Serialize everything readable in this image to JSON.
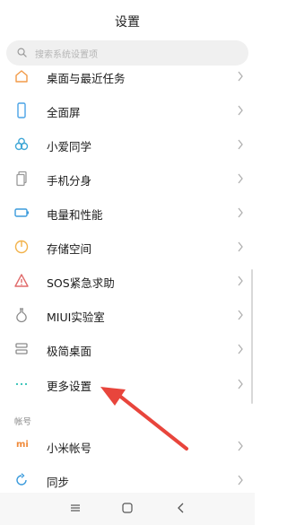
{
  "header": {
    "title": "设置"
  },
  "search": {
    "placeholder": "搜索系统设置项"
  },
  "rows": [
    {
      "label": "桌面与最近任务",
      "icon": "home-screen-icon",
      "color": "#f29a48"
    },
    {
      "label": "全面屏",
      "icon": "phone-screen-icon",
      "color": "#4aa3e6"
    },
    {
      "label": "小爱同学",
      "icon": "assistant-icon",
      "color": "#3fa7d6"
    },
    {
      "label": "手机分身",
      "icon": "second-space-icon",
      "color": "#9a9a9a"
    },
    {
      "label": "电量和性能",
      "icon": "battery-icon",
      "color": "#3b9bdc"
    },
    {
      "label": "存储空间",
      "icon": "storage-icon",
      "color": "#f2b24a"
    },
    {
      "label": "SOS紧急求助",
      "icon": "sos-warning-icon",
      "color": "#e06a6a"
    },
    {
      "label": "MIUI实验室",
      "icon": "lab-flask-icon",
      "color": "#8a8a8a"
    },
    {
      "label": "极简桌面",
      "icon": "simple-desktop-icon",
      "color": "#8a8a8a"
    },
    {
      "label": "更多设置",
      "icon": "more-dots-icon",
      "color": "#2ec0b5"
    }
  ],
  "section": {
    "label": "帐号"
  },
  "account_rows": [
    {
      "label": "小米帐号",
      "icon": "mi-account-icon",
      "color": "#f08a3a",
      "icon_text": "mi"
    },
    {
      "label": "同步",
      "icon": "sync-icon",
      "color": "#3b9bdc"
    }
  ],
  "annotation": {
    "arrow_color": "#e8453c"
  }
}
